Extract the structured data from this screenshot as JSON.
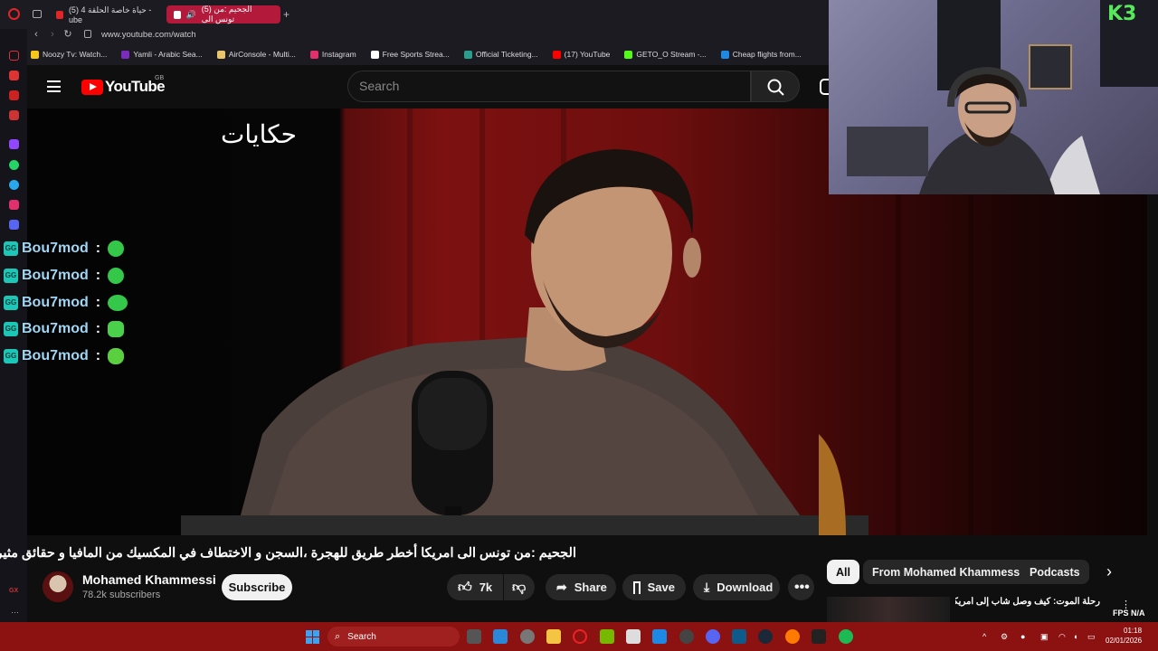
{
  "browser": {
    "tabs": [
      {
        "label": "(5) حياة خاصة الحلقة 4 - ube"
      },
      {
        "label": "(5) الجحيم :من تونس الى"
      }
    ],
    "new_tab": "+",
    "url": "www.youtube.com/watch",
    "bookmarks": [
      {
        "label": "Noozy Tv: Watch...",
        "color": "#f5c518"
      },
      {
        "label": "Yamli - Arabic Sea...",
        "color": "#7b2cbf"
      },
      {
        "label": "AirConsole - Multi...",
        "color": "#e9c46a"
      },
      {
        "label": "Instagram",
        "color": "#e1306c"
      },
      {
        "label": "Free Sports Strea...",
        "color": "#ffffff"
      },
      {
        "label": "Official Ticketing...",
        "color": "#2a9d8f"
      },
      {
        "label": "(17) YouTube",
        "color": "#ff0000"
      },
      {
        "label": "GETO_O Stream -...",
        "color": "#53fc18"
      },
      {
        "label": "Cheap flights from...",
        "color": "#1e88e5"
      }
    ]
  },
  "youtube": {
    "logo_text": "YouTube",
    "region": "GB",
    "search_placeholder": "Search"
  },
  "video": {
    "overlay_logo": "حكايات"
  },
  "chat": [
    {
      "user": "Bou7mod",
      "colon": ":"
    },
    {
      "user": "Bou7mod",
      "colon": ":"
    },
    {
      "user": "Bou7mod",
      "colon": ":"
    },
    {
      "user": "Bou7mod",
      "colon": ":"
    },
    {
      "user": "Bou7mod",
      "colon": ":"
    }
  ],
  "video_title": "الجحيم :من تونس الى امريكا أخطر طريق للهجرة ،السجن و الاختطاف في المكسيك من المافيا و حقائق مثيرة!",
  "channel": {
    "name": "Mohamed Khammessi",
    "subscribers": "78.2k subscribers",
    "subscribe_label": "Subscribe"
  },
  "actions": {
    "likes": "7k",
    "share": "Share",
    "save": "Save",
    "download": "Download"
  },
  "chips": [
    "All",
    "From Mohamed Khammessi",
    "Podcasts"
  ],
  "recommended": {
    "title": "رحلة الموت: كيف وصل شاب إلى أمريكا عبر أخطر طريق للهجرة"
  },
  "stream_overlay": {
    "webcam_logo": "K3",
    "fps": "FPS N/A"
  },
  "taskbar": {
    "search_label": "Search",
    "time": "01:18",
    "date": "02/01/2026"
  },
  "colors": {
    "taskbar": "#8c1212",
    "tab_active": "#b3193a",
    "yt_red": "#ff0000",
    "chat_username": "#9fd6f4"
  }
}
